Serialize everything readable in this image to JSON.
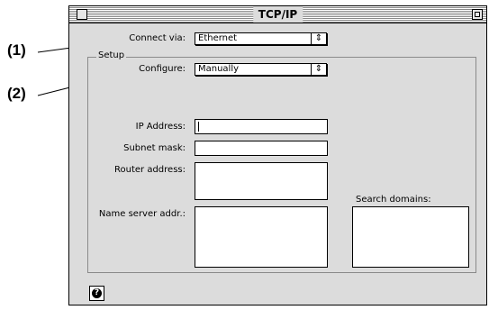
{
  "callouts": [
    "(1)",
    "(2)"
  ],
  "window": {
    "title": "TCP/IP"
  },
  "connect": {
    "label": "Connect via:",
    "value": "Ethernet"
  },
  "setup": {
    "legend": "Setup",
    "configure_label": "Configure:",
    "configure_value": "Manually",
    "ip_label": "IP Address:",
    "subnet_label": "Subnet mask:",
    "router_label": "Router address:",
    "nameserver_label": "Name server addr.:",
    "search_label": "Search domains:"
  },
  "help_icon": "question-mark-icon",
  "popup_arrow": "⇕"
}
